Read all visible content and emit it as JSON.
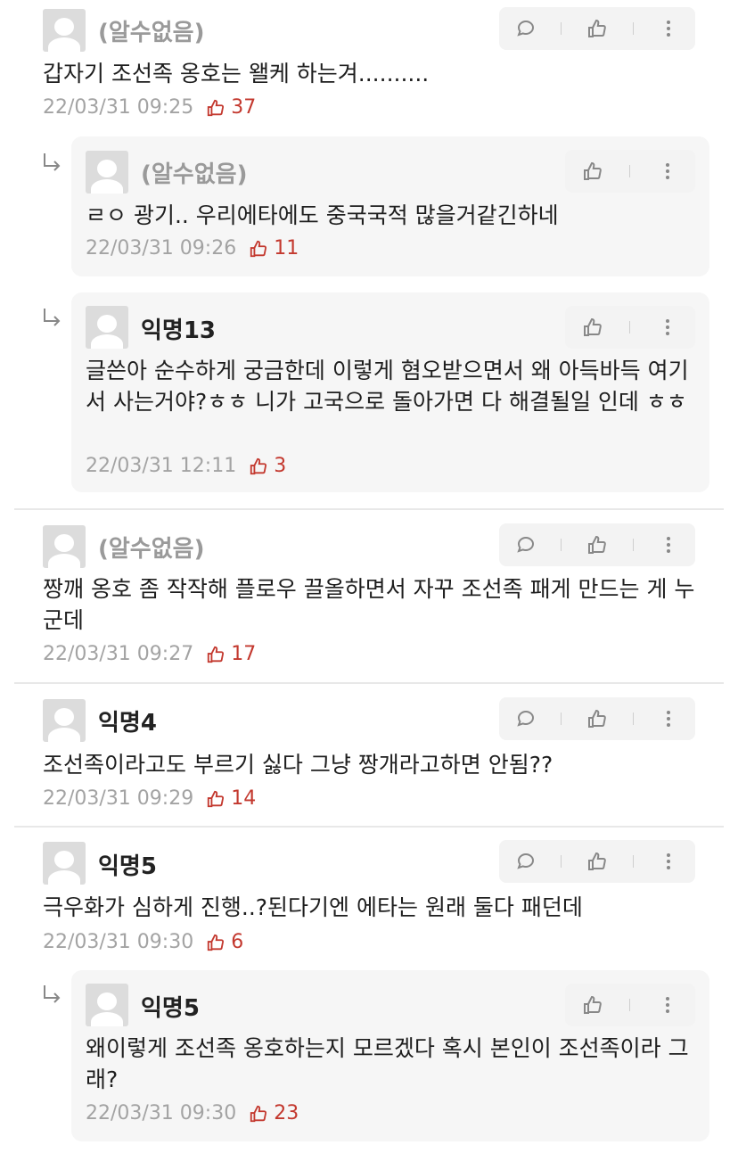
{
  "comments": [
    {
      "author": "(알수없음)",
      "text": "갑자기 조선족 옹호는 왤케 하는겨..........",
      "time": "22/03/31 09:25",
      "likes": "37"
    },
    {
      "author": "(알수없음)",
      "text": "ㄹㅇ 광기.. 우리에타에도 중국국적 많을거같긴하네",
      "time": "22/03/31 09:26",
      "likes": "11"
    },
    {
      "author": "익명13",
      "text": "글쓴아 순수하게 궁금한데 이렇게 혐오받으면서 왜 아득바득 여기서 사는거야?ㅎㅎ 니가 고국으로 돌아가면 다 해결될일 인데 ㅎㅎ",
      "time": "22/03/31 12:11",
      "likes": "3"
    },
    {
      "author": "(알수없음)",
      "text": "짱깨 옹호 좀 작작해 플로우 끌올하면서 자꾸 조선족 패게 만드는 게 누군데",
      "time": "22/03/31 09:27",
      "likes": "17"
    },
    {
      "author": "익명4",
      "text": "조선족이라고도 부르기 싫다 그냥 짱개라고하면 안됨??",
      "time": "22/03/31 09:29",
      "likes": "14"
    },
    {
      "author": "익명5",
      "text": "극우화가 심하게 진행..?된다기엔 에타는 원래 둘다 패던데",
      "time": "22/03/31 09:30",
      "likes": "6"
    },
    {
      "author": "익명5",
      "text": "왜이렇게 조선족 옹호하는지 모르겠다 혹시 본인이 조선족이라 그래?",
      "time": "22/03/31 09:30",
      "likes": "23"
    }
  ],
  "icons": {
    "comment": "comment-icon",
    "like": "thumbs-up-icon",
    "more": "more-vertical-icon",
    "reply": "reply-arrow-icon"
  },
  "colors": {
    "like": "#c3382e",
    "unknown_author": "#9a9a9a",
    "reply_bg": "#f6f6f6"
  }
}
